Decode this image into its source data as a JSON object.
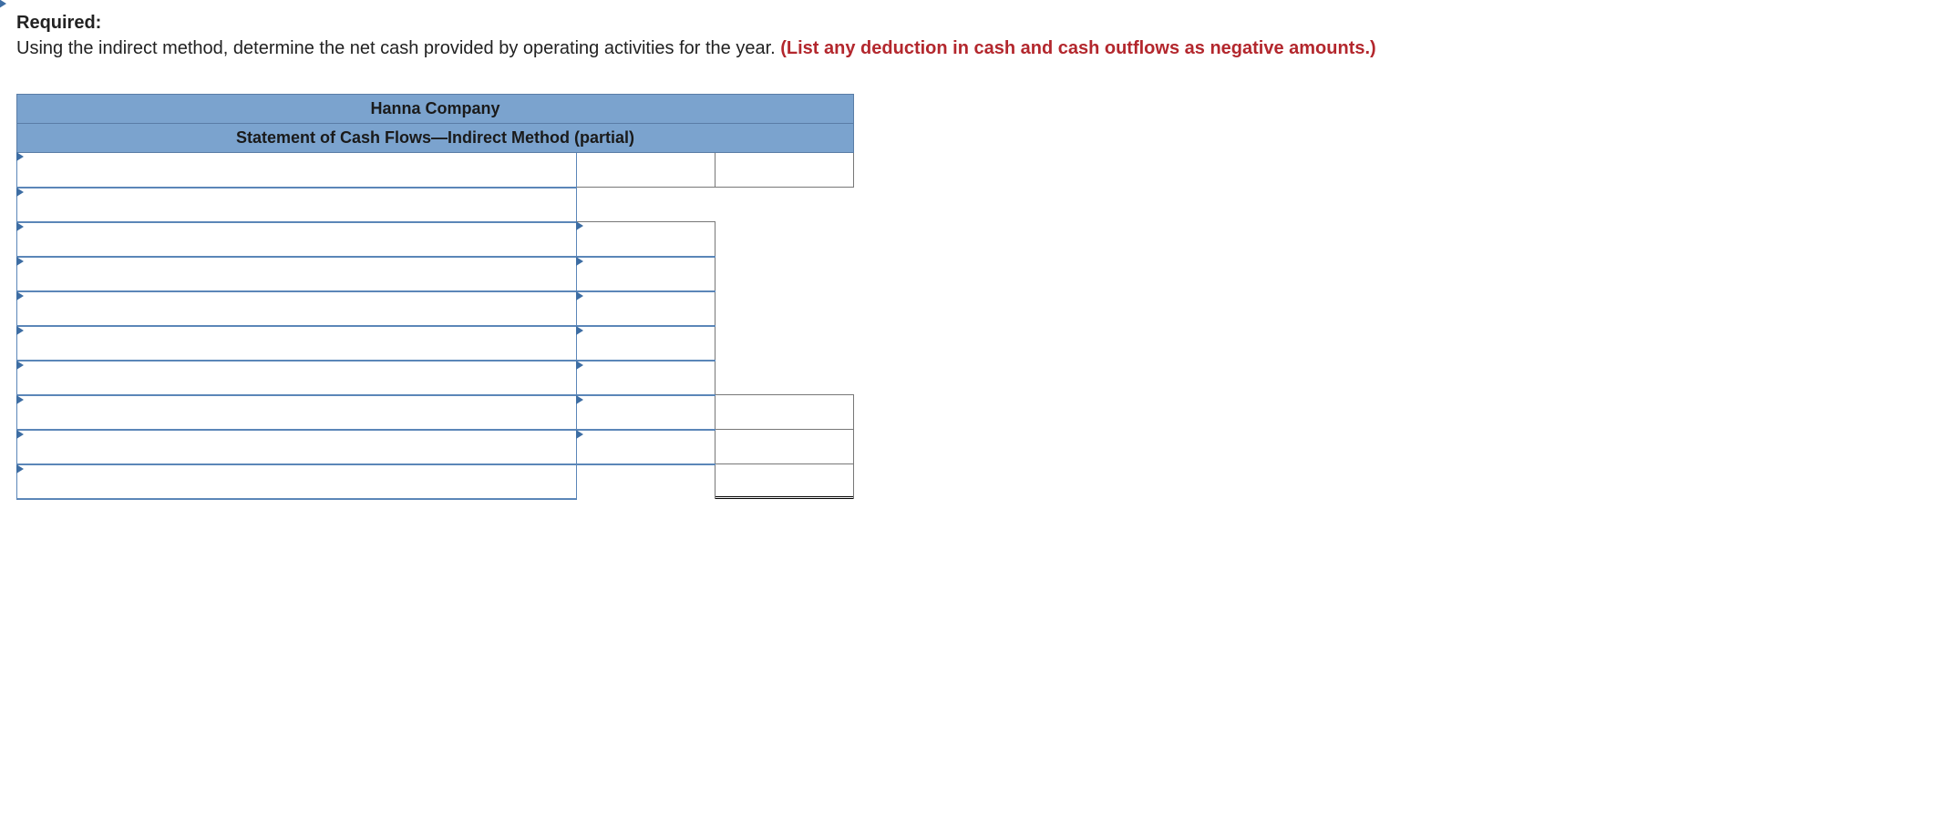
{
  "header": {
    "required_label": "Required:",
    "instruction_plain": "Using the indirect method, determine the net cash provided by operating activities for the year. ",
    "instruction_red": "(List any deduction in cash and cash outflows as negative amounts.)"
  },
  "table": {
    "title_line1": "Hanna Company",
    "title_line2": "Statement of Cash Flows—Indirect Method (partial)",
    "rows": [
      {
        "desc": "",
        "c1": "",
        "c2": "",
        "desc_dd": true,
        "c1_dd": false,
        "c2_dd": true,
        "c1_border": "plain",
        "c2_border": "plain"
      },
      {
        "desc": "",
        "c1": "",
        "c2": "",
        "desc_dd": true,
        "c1_dd": false,
        "c2_dd": false,
        "c1_border": "none",
        "c2_border": "none"
      },
      {
        "desc": "",
        "c1": "",
        "c2": "",
        "desc_dd": true,
        "c1_dd": true,
        "c2_dd": false,
        "c1_border": "drop",
        "c2_border": "none"
      },
      {
        "desc": "",
        "c1": "",
        "c2": "",
        "desc_dd": true,
        "c1_dd": true,
        "c2_dd": false,
        "c1_border": "drop",
        "c2_border": "none"
      },
      {
        "desc": "",
        "c1": "",
        "c2": "",
        "desc_dd": true,
        "c1_dd": true,
        "c2_dd": false,
        "c1_border": "drop",
        "c2_border": "none"
      },
      {
        "desc": "",
        "c1": "",
        "c2": "",
        "desc_dd": true,
        "c1_dd": true,
        "c2_dd": false,
        "c1_border": "drop",
        "c2_border": "none"
      },
      {
        "desc": "",
        "c1": "",
        "c2": "",
        "desc_dd": true,
        "c1_dd": true,
        "c2_dd": false,
        "c1_border": "drop",
        "c2_border": "none"
      },
      {
        "desc": "",
        "c1": "",
        "c2": "",
        "desc_dd": true,
        "c1_dd": true,
        "c2_dd": false,
        "c1_border": "drop",
        "c2_border": "plain"
      },
      {
        "desc": "",
        "c1": "",
        "c2": "",
        "desc_dd": true,
        "c1_dd": true,
        "c2_dd": false,
        "c1_border": "drop",
        "c2_border": "plain"
      },
      {
        "desc": "",
        "c1": "",
        "c2": "",
        "desc_dd": true,
        "c1_dd": false,
        "c2_dd": false,
        "c1_border": "none",
        "c2_border": "dbl"
      }
    ]
  }
}
